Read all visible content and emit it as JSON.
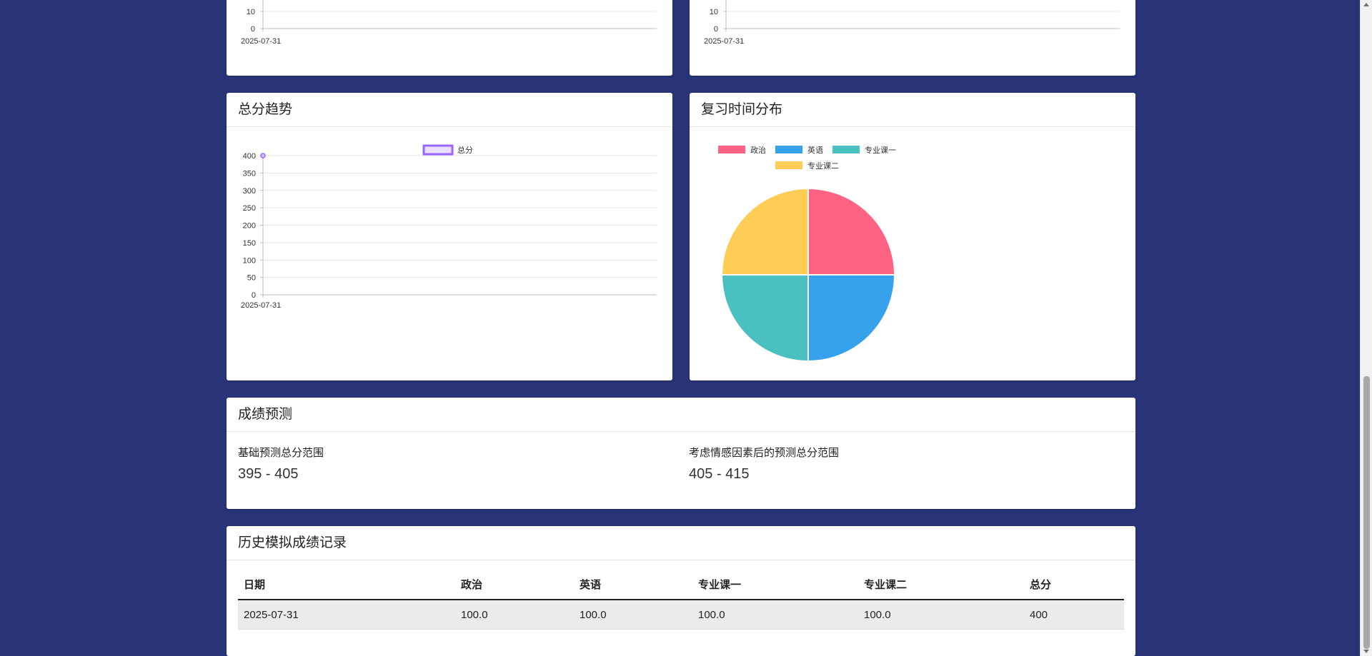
{
  "colors": {
    "background": "#283477",
    "politics": "#ff6384",
    "english": "#36a2eb",
    "major1": "#4bc0c0",
    "major2": "#ffcd56",
    "total": "#9966ff"
  },
  "top_charts": [
    {
      "yticks": [
        "10",
        "0"
      ],
      "xticks": [
        "2025-07-31"
      ]
    },
    {
      "yticks": [
        "10",
        "0"
      ],
      "xticks": [
        "2025-07-31"
      ]
    }
  ],
  "total_trend": {
    "title": "总分趋势",
    "chart_data": {
      "type": "line",
      "x": [
        "2025-07-31"
      ],
      "series": [
        {
          "name": "总分",
          "values": [
            400
          ]
        }
      ],
      "ylim": [
        0,
        400
      ],
      "yticks": [
        "400",
        "350",
        "300",
        "250",
        "200",
        "150",
        "100",
        "50",
        "0"
      ],
      "xticks": [
        "2025-07-31"
      ],
      "legend": "top",
      "grid": true
    }
  },
  "review_time": {
    "title": "复习时间分布",
    "chart_data": {
      "type": "pie",
      "categories": [
        "政治",
        "英语",
        "专业课一",
        "专业课二"
      ],
      "values": [
        25,
        25,
        25,
        25
      ],
      "legend": "top"
    }
  },
  "prediction": {
    "title": "成绩预测",
    "basic_label": "基础预测总分范围",
    "basic_value": "395 - 405",
    "emotional_label": "考虑情感因素后的预测总分范围",
    "emotional_value": "405 - 415"
  },
  "history": {
    "title": "历史模拟成绩记录",
    "columns": [
      "日期",
      "政治",
      "英语",
      "专业课一",
      "专业课二",
      "总分"
    ],
    "rows": [
      [
        "2025-07-31",
        "100.0",
        "100.0",
        "100.0",
        "100.0",
        "400"
      ]
    ]
  }
}
